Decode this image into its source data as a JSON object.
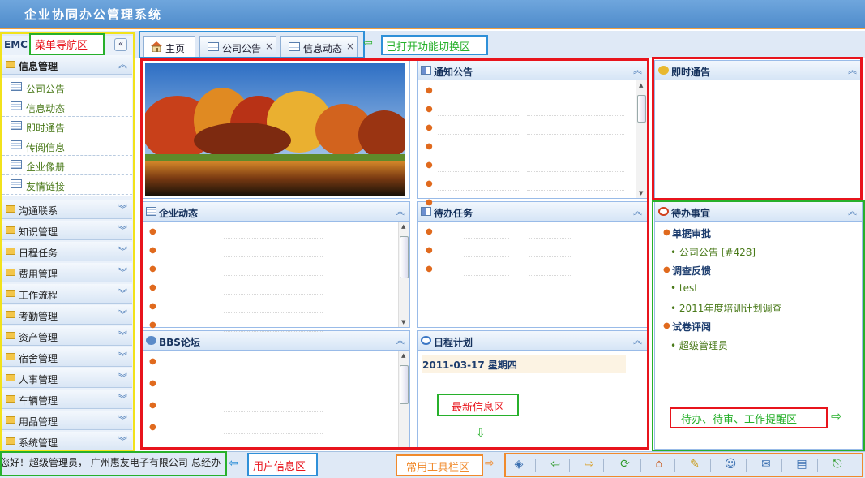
{
  "app": {
    "title": "企业协同办公管理系统"
  },
  "sidebar": {
    "brand": "EMC",
    "groups": [
      {
        "label": "信息管理"
      },
      {
        "label": "沟通联系"
      },
      {
        "label": "知识管理"
      },
      {
        "label": "日程任务"
      },
      {
        "label": "费用管理"
      },
      {
        "label": "工作流程"
      },
      {
        "label": "考勤管理"
      },
      {
        "label": "资产管理"
      },
      {
        "label": "宿舍管理"
      },
      {
        "label": "人事管理"
      },
      {
        "label": "车辆管理"
      },
      {
        "label": "用品管理"
      },
      {
        "label": "系统管理"
      }
    ],
    "items": [
      {
        "label": "公司公告"
      },
      {
        "label": "信息动态"
      },
      {
        "label": "即时通告"
      },
      {
        "label": "传阅信息"
      },
      {
        "label": "企业像册"
      },
      {
        "label": "友情链接"
      }
    ]
  },
  "tabs": [
    {
      "label": "主页"
    },
    {
      "label": "公司公告"
    },
    {
      "label": "信息动态"
    }
  ],
  "panels": {
    "notice": "通知公告",
    "instant": "即时通告",
    "company_news": "企业动态",
    "tasks": "待办任务",
    "todo": "待办事宜",
    "bbs": "BBS论坛",
    "schedule": "日程计划"
  },
  "todo": [
    {
      "heading": "单据审批",
      "items": [
        "公司公告 [#428]"
      ]
    },
    {
      "heading": "调查反馈",
      "items": [
        "test",
        "2011年度培训计划调查"
      ]
    },
    {
      "heading": "试卷评阅",
      "items": [
        "超级管理员"
      ]
    }
  ],
  "schedule": {
    "date_line": "2011-03-17  星期四"
  },
  "status": {
    "user_info": "您好！超级管理员，  广州惠友电子有限公司-总经办"
  },
  "annotations": {
    "menu_nav": "菜单导航区",
    "opened_tabs": "已打开功能切换区",
    "latest_info": "最新信息区",
    "reminder": "待办、待审、工作提醒区",
    "user_info": "用户信息区",
    "toolbar": "常用工具栏区"
  },
  "icons": [
    "tag-icon",
    "back-icon",
    "forward-icon",
    "refresh-icon",
    "home-icon",
    "edit-icon",
    "user-icon",
    "chat-icon",
    "message-icon",
    "exit-icon"
  ],
  "colors": {
    "annotation_red": "#e8141c",
    "annotation_green": "#27b02b",
    "annotation_blue": "#2f90d8",
    "annotation_orange": "#f08a2c",
    "annotation_yellow": "#f2e21b"
  }
}
